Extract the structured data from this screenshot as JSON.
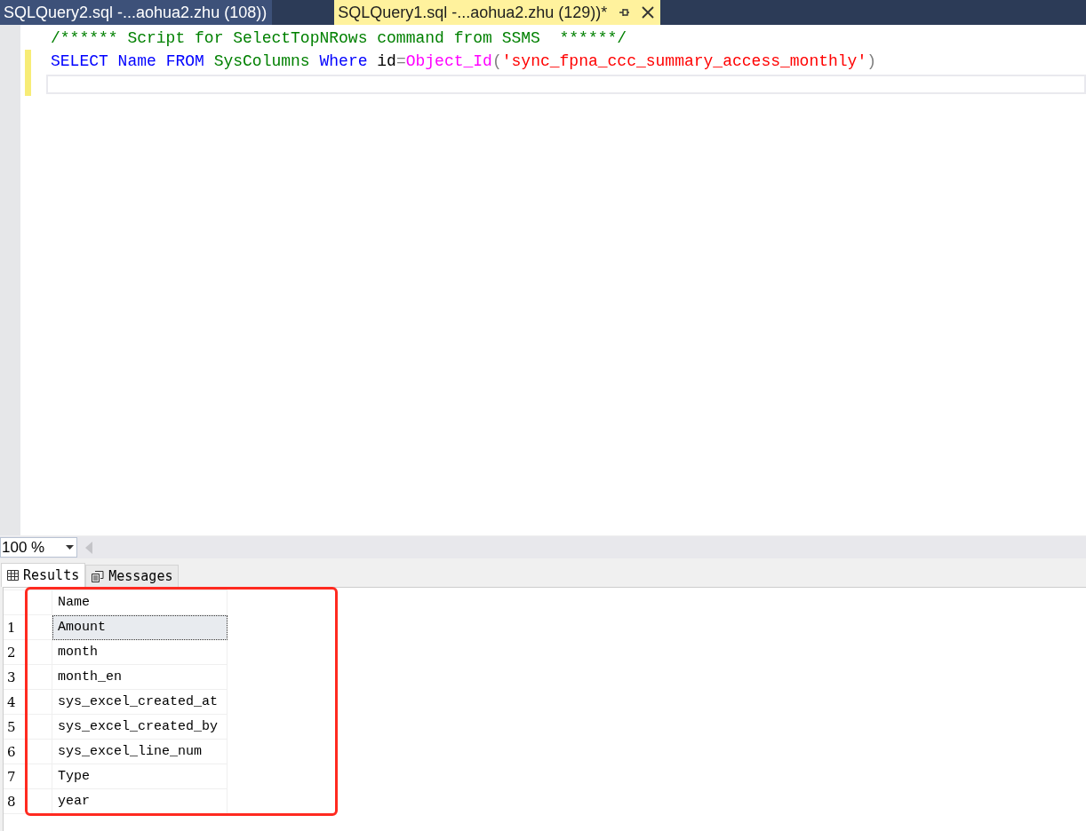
{
  "document_tabs": [
    {
      "label": "SQLQuery2.sql -...aohua2.zhu (108))",
      "selected": false
    },
    {
      "label": "SQLQuery1.sql -...aohua2.zhu (129))*",
      "selected": true
    }
  ],
  "editor": {
    "lines": [
      {
        "changed": false,
        "current": false,
        "tokens": [
          {
            "kind": "comment",
            "text": "/****** Script for SelectTopNRows command from SSMS  ******/"
          }
        ]
      },
      {
        "changed": true,
        "current": false,
        "tokens": [
          {
            "kind": "keyword",
            "text": "SELECT"
          },
          {
            "kind": "keyword",
            "text": " Name"
          },
          {
            "kind": "keyword",
            "text": " FROM"
          },
          {
            "kind": "system",
            "text": " SysColumns"
          },
          {
            "kind": "keyword",
            "text": " Where"
          },
          {
            "kind": "plain",
            "text": " id"
          },
          {
            "kind": "operator",
            "text": "="
          },
          {
            "kind": "function",
            "text": "Object_Id"
          },
          {
            "kind": "operator",
            "text": "("
          },
          {
            "kind": "string",
            "text": "'sync_fpna_ccc_summary_access_monthly'"
          },
          {
            "kind": "operator",
            "text": ")"
          }
        ]
      },
      {
        "changed": true,
        "current": true
      }
    ]
  },
  "zoom": "100 %",
  "result_tabs": [
    {
      "label": "Results",
      "kind": "grid",
      "selected": true
    },
    {
      "label": "Messages",
      "kind": "messages",
      "selected": false
    }
  ],
  "grid": {
    "columns": [
      "Name"
    ],
    "rows": [
      {
        "number": "1",
        "cells": [
          "Amount"
        ],
        "selected": true
      },
      {
        "number": "2",
        "cells": [
          "month"
        ],
        "selected": false
      },
      {
        "number": "3",
        "cells": [
          "month_en"
        ],
        "selected": false
      },
      {
        "number": "4",
        "cells": [
          "sys_excel_created_at"
        ],
        "selected": false
      },
      {
        "number": "5",
        "cells": [
          "sys_excel_created_by"
        ],
        "selected": false
      },
      {
        "number": "6",
        "cells": [
          "sys_excel_line_num"
        ],
        "selected": false
      },
      {
        "number": "7",
        "cells": [
          "Type"
        ],
        "selected": false
      },
      {
        "number": "8",
        "cells": [
          "year"
        ],
        "selected": false
      }
    ]
  }
}
